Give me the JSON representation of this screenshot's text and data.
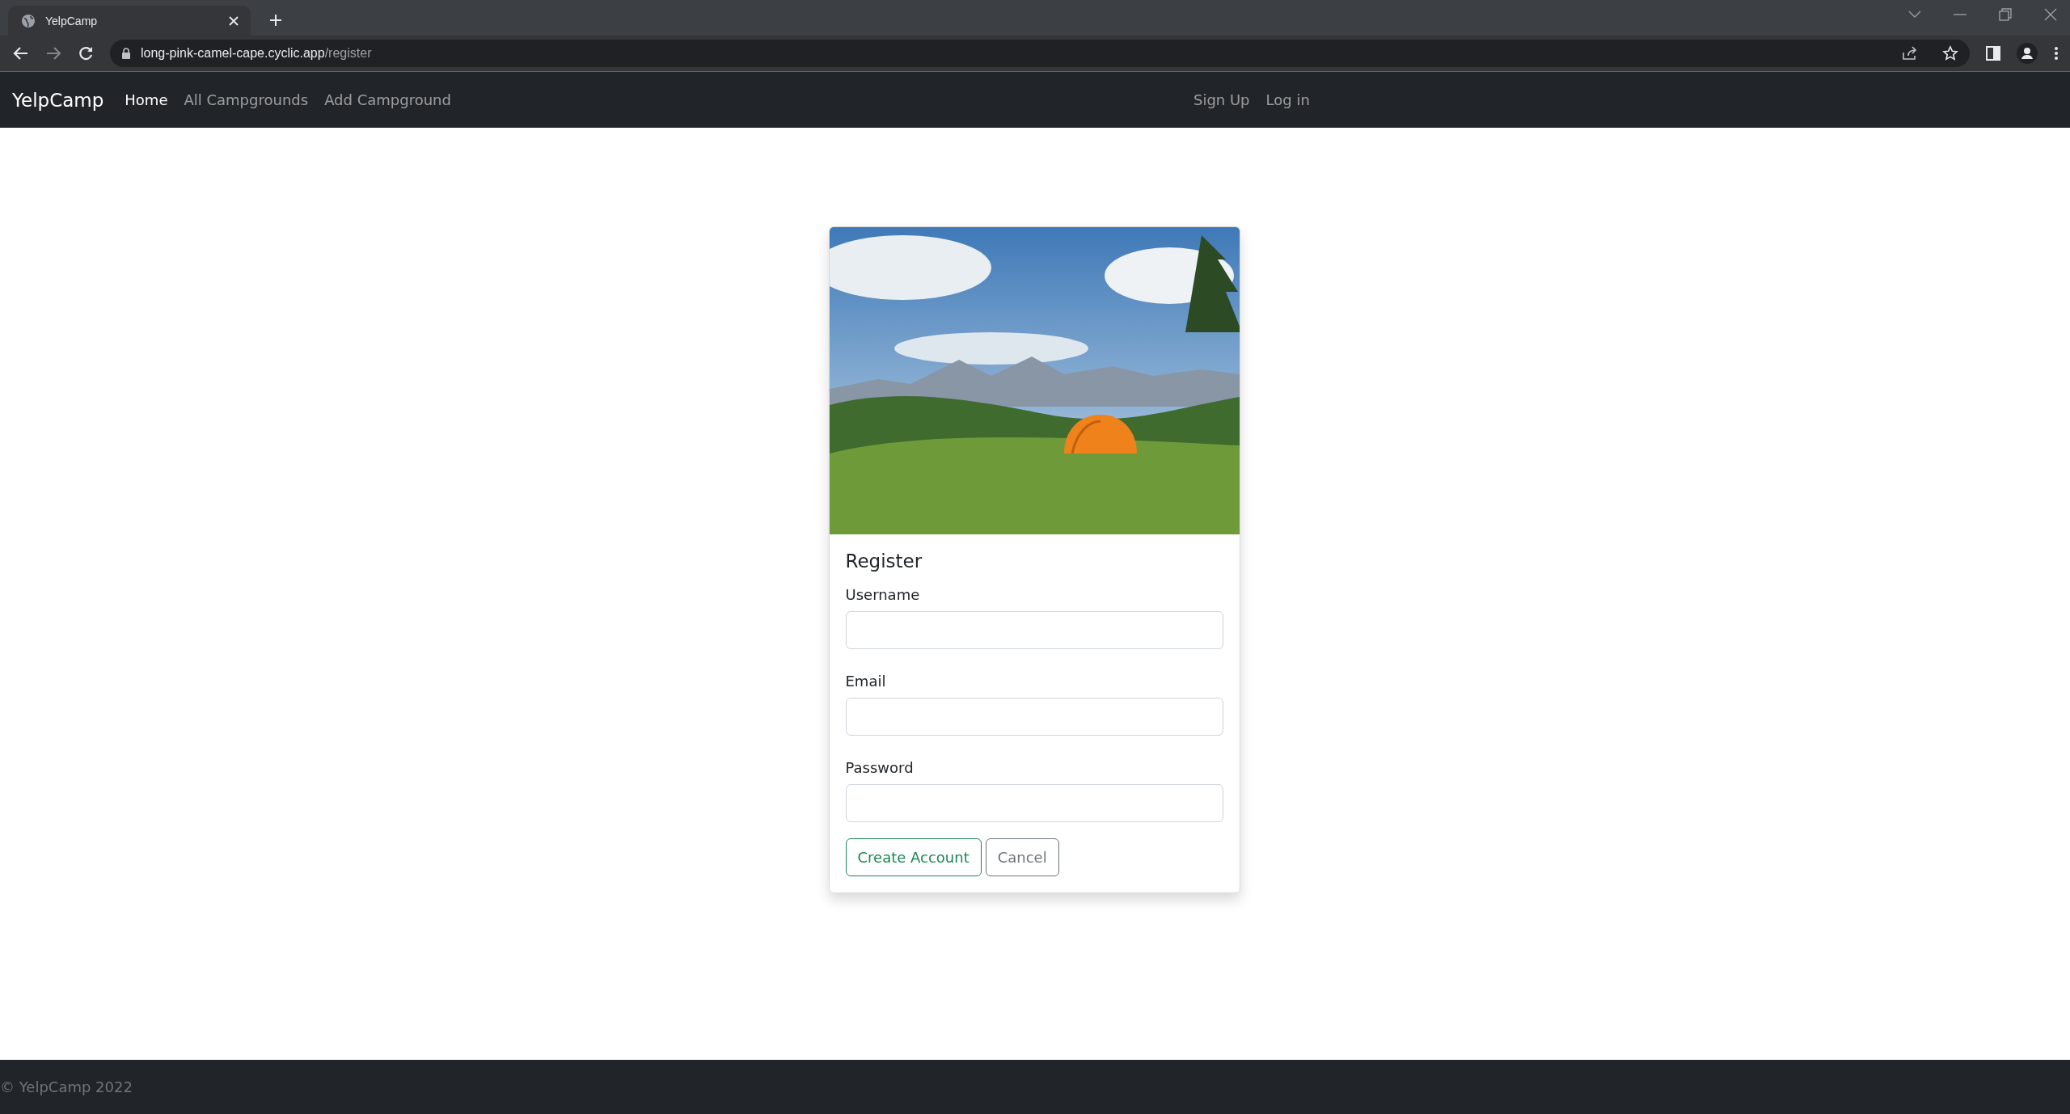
{
  "browser": {
    "tab": {
      "title": "YelpCamp",
      "selected": true
    },
    "url": {
      "host": "long-pink-camel-cape.cyclic.app",
      "path": "/register"
    }
  },
  "navbar": {
    "brand": "YelpCamp",
    "links": [
      {
        "label": "Home",
        "selected": true
      },
      {
        "label": "All Campgrounds",
        "selected": false
      },
      {
        "label": "Add Campground",
        "selected": false
      }
    ],
    "auth_links": [
      {
        "label": "Sign Up"
      },
      {
        "label": "Log in"
      }
    ]
  },
  "form": {
    "title": "Register",
    "fields": [
      {
        "label": "Username"
      },
      {
        "label": "Email"
      },
      {
        "label": "Password"
      }
    ],
    "buttons": [
      {
        "label": "Create Account",
        "kind": "primary"
      },
      {
        "label": "Cancel",
        "kind": "secondary"
      }
    ]
  },
  "footer": {
    "text": "© YelpCamp 2022"
  }
}
